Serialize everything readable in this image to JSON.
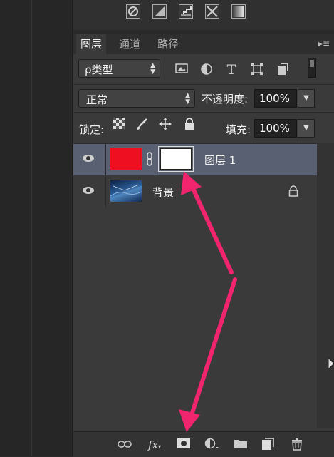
{
  "colors": {
    "panel_bg": "#3a3a3a",
    "selected_layer": "#586071",
    "annotation_arrow": "#f0256e",
    "layer1_color": "#ee1020",
    "mask_color": "#ffffff"
  },
  "adjustments_icons": [
    "brightness-icon",
    "levels-icon",
    "curves-icon",
    "exposure-icon",
    "gradient-map-icon"
  ],
  "layers_panel": {
    "tabs": [
      {
        "label": "图层",
        "active": true
      },
      {
        "label": "通道",
        "active": false
      },
      {
        "label": "路径",
        "active": false
      }
    ],
    "menu_icon": "panel-menu-icon",
    "filter": {
      "label": "ρ类型",
      "icons": [
        "image-filter-icon",
        "adjustment-filter-icon",
        "type-filter-icon",
        "shape-filter-icon",
        "smart-object-filter-icon",
        "filter-toggle-icon"
      ]
    },
    "blend": {
      "mode": "正常",
      "opacity_label": "不透明度:",
      "opacity_value": "100%"
    },
    "lock": {
      "label": "锁定:",
      "icons": [
        "lock-transparent-icon",
        "lock-paint-icon",
        "lock-position-icon",
        "lock-all-icon"
      ],
      "fill_label": "填充:",
      "fill_value": "100%"
    },
    "layers": [
      {
        "name": "图层 1",
        "visible": true,
        "selected": true,
        "has_mask": true,
        "locked": false
      },
      {
        "name": "背景",
        "visible": true,
        "selected": false,
        "has_mask": false,
        "locked": true
      }
    ],
    "bottom_icons": [
      "link-layers-icon",
      "fx-icon",
      "add-mask-icon",
      "adjustment-layer-icon",
      "new-group-icon",
      "new-layer-icon",
      "delete-icon"
    ],
    "fx_label": "fx"
  }
}
